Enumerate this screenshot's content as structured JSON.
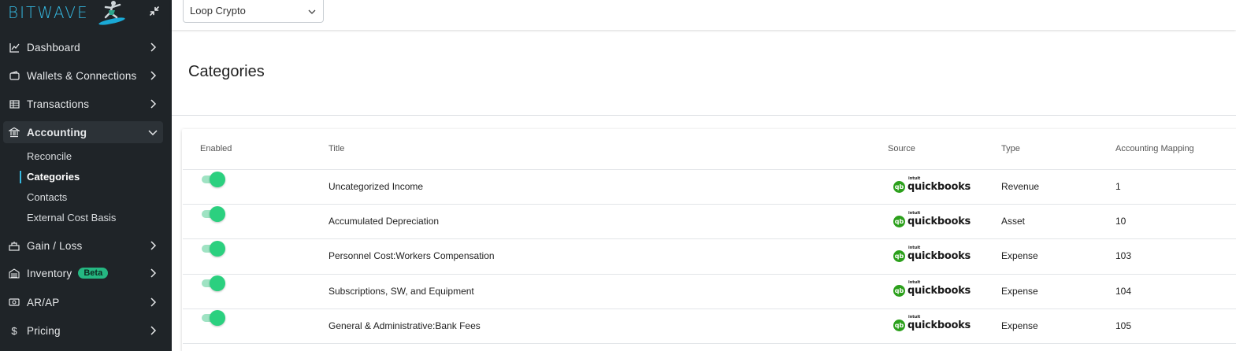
{
  "brand": {
    "logo_text": "BITWAVE"
  },
  "org_selector": {
    "value": "Loop Crypto"
  },
  "nav": [
    {
      "label": "Dashboard",
      "icon": "chart-line-icon",
      "expanded": false
    },
    {
      "label": "Wallets & Connections",
      "icon": "wallet-icon",
      "expanded": false
    },
    {
      "label": "Transactions",
      "icon": "table-icon",
      "expanded": false
    },
    {
      "label": "Accounting",
      "icon": "bank-icon",
      "expanded": true,
      "active": true
    },
    {
      "label": "Gain / Loss",
      "icon": "scale-icon",
      "expanded": false
    },
    {
      "label": "Inventory",
      "icon": "inventory-icon",
      "badge": "Beta",
      "expanded": false
    },
    {
      "label": "AR/AP",
      "icon": "cash-icon",
      "expanded": false
    },
    {
      "label": "Pricing",
      "icon": "dollar-icon",
      "expanded": false
    }
  ],
  "accounting_subnav": [
    {
      "label": "Reconcile",
      "active": false
    },
    {
      "label": "Categories",
      "active": true
    },
    {
      "label": "Contacts",
      "active": false
    },
    {
      "label": "External Cost Basis",
      "active": false
    }
  ],
  "page": {
    "title": "Categories"
  },
  "table": {
    "columns": [
      "Enabled",
      "Title",
      "Source",
      "Type",
      "Accounting Mapping"
    ],
    "rows": [
      {
        "enabled": true,
        "title": "Uncategorized Income",
        "source": "quickbooks",
        "type": "Revenue",
        "mapping": "1"
      },
      {
        "enabled": true,
        "title": "Accumulated Depreciation",
        "source": "quickbooks",
        "type": "Asset",
        "mapping": "10"
      },
      {
        "enabled": true,
        "title": "Personnel Cost:Workers Compensation",
        "source": "quickbooks",
        "type": "Expense",
        "mapping": "103"
      },
      {
        "enabled": true,
        "title": "Subscriptions, SW, and Equipment",
        "source": "quickbooks",
        "type": "Expense",
        "mapping": "104"
      },
      {
        "enabled": true,
        "title": "General & Administrative:Bank Fees",
        "source": "quickbooks",
        "type": "Expense",
        "mapping": "105"
      }
    ]
  },
  "source_logo": {
    "mark": "qb",
    "small": "intuit",
    "name": "quickbooks"
  },
  "colors": {
    "sidebar_bg": "#1f2428",
    "accent": "#35b8e0",
    "toggle_on": "#2bd07f",
    "badge": "#25b882",
    "quickbooks_green": "#2ca01c"
  }
}
